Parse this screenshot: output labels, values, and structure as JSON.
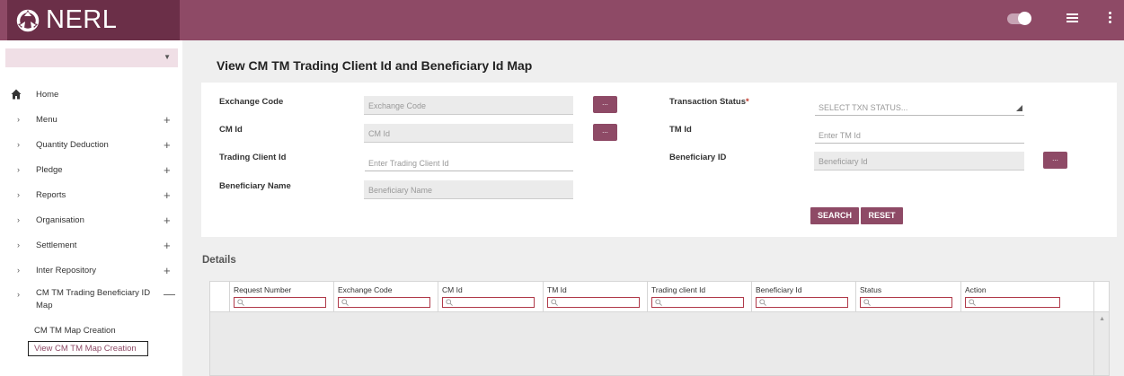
{
  "app": {
    "logo_text": "NERL"
  },
  "header": {
    "toggle_icon": "toggle-switch-icon",
    "menu_icon": "list-icon",
    "more_icon": "kebab-icon"
  },
  "sidebar": {
    "select_value": "",
    "items": [
      {
        "label": "Home",
        "icon": "home-icon"
      },
      {
        "label": "Menu"
      },
      {
        "label": "Quantity Deduction"
      },
      {
        "label": "Pledge"
      },
      {
        "label": "Reports"
      },
      {
        "label": "Organisation"
      },
      {
        "label": "Settlement"
      },
      {
        "label": "Inter Repository"
      },
      {
        "label_line1": "CM TM Trading Beneficiary ID",
        "label_line2": "Map",
        "expanded": true
      }
    ],
    "sub_items": [
      {
        "label": "CM TM Map Creation"
      },
      {
        "label": "View CM TM Map Creation",
        "active": true
      }
    ],
    "plus": "+",
    "minus": "—"
  },
  "page": {
    "title": "View CM TM Trading Client Id and Beneficiary Id Map"
  },
  "form": {
    "exchange_code": {
      "label": "Exchange Code",
      "placeholder": "Exchange Code"
    },
    "cm_id": {
      "label": "CM Id",
      "placeholder": "CM Id"
    },
    "trading_client_id": {
      "label": "Trading Client Id",
      "placeholder": "Enter Trading Client Id"
    },
    "beneficiary_name": {
      "label": "Beneficiary Name",
      "placeholder": "Beneficiary Name"
    },
    "transaction_status": {
      "label": "Transaction Status",
      "required_mark": "*",
      "placeholder": "SELECT TXN STATUS..."
    },
    "tm_id": {
      "label": "TM Id",
      "placeholder": "Enter TM Id"
    },
    "beneficiary_id": {
      "label": "Beneficiary ID",
      "placeholder": "Beneficiary Id"
    },
    "lookup_label": "...",
    "search_label": "SEARCH",
    "reset_label": "RESET"
  },
  "details": {
    "title": "Details",
    "columns": [
      "Request Number",
      "Exchange Code",
      "CM Id",
      "TM Id",
      "Trading client Id",
      "Beneficiary Id",
      "Status",
      "Action"
    ],
    "rows": []
  },
  "colors": {
    "brand": "#8e4a66",
    "brand_dark": "#6b2f48",
    "accent_light": "#f0dfe6"
  }
}
